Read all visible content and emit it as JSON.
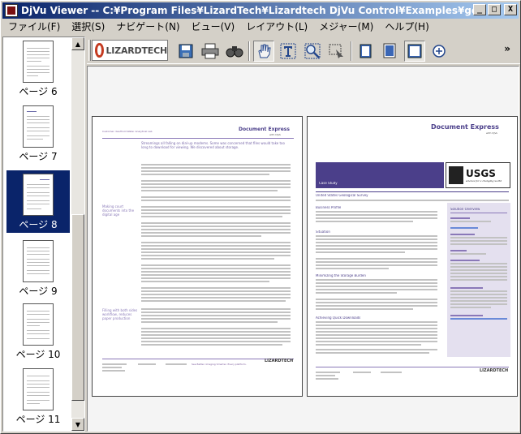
{
  "window": {
    "title": "DjVu Viewer -- C:¥Program Files¥LizardTech¥Lizardtech DjVu Control¥Examples¥general.djvu",
    "buttons": {
      "minimize": "_",
      "maximize": "□",
      "close": "X"
    }
  },
  "menu": [
    "ファイル(F)",
    "選択(S)",
    "ナビゲート(N)",
    "ビュー(V)",
    "レイアウト(L)",
    "メジャー(M)",
    "ヘルプ(H)"
  ],
  "sidebar": {
    "thumbnails": [
      {
        "label": "ページ 6",
        "selected": false
      },
      {
        "label": "ページ 7",
        "selected": false
      },
      {
        "label": "ページ 8",
        "selected": true
      },
      {
        "label": "ページ 9",
        "selected": false
      },
      {
        "label": "ページ 10",
        "selected": false
      },
      {
        "label": "ページ 11",
        "selected": false
      }
    ]
  },
  "toolbar": {
    "logo_text": "LIZARDTECH",
    "tools": [
      "save-icon",
      "print-icon",
      "find-icon",
      "hand-icon",
      "text-select-icon",
      "zoom-icon",
      "region-select-icon",
      "single-page-icon",
      "continuous-icon",
      "facing-pages-icon",
      "zoom-in-icon"
    ],
    "active_tool": "hand-icon",
    "overflow": "»"
  },
  "document": {
    "left_page": {
      "header_left": "Customer: Kaufhold Water Analytical Lab",
      "brand": "Document Express",
      "brand_sub": "with DjVu",
      "heading": "Streamings all falling on dial-up modems. Some was concerned that files would take too long to download for viewing. We discovered about storage.",
      "side_note_1": "Making court documents into the digital age",
      "side_note_2": "Filling with both sides workflow, reduces paper production",
      "footer_company": "LIZARDTECH",
      "footer_tag": "See Better. Imaging Smarter. Every platform."
    },
    "right_page": {
      "brand": "Document Express",
      "brand_sub": "with DjVu",
      "case_label": "Case Study",
      "org": "USGS",
      "org_tagline": "science for a changing world",
      "subtitle": "United States Geological Survey",
      "section_1": "Business Profile",
      "section_2": "Situation",
      "section_3": "Minimizing the Storage Burden",
      "section_4": "Achieving Quick Downloads",
      "sidebar_title": "Solution Overview",
      "footer_company": "LIZARDTECH"
    }
  },
  "colors": {
    "title_start": "#0a246a",
    "title_end": "#a6caf0",
    "selection": "#0a246a",
    "brand_purple": "#4b3f8a",
    "logo_red": "#c43a20"
  }
}
